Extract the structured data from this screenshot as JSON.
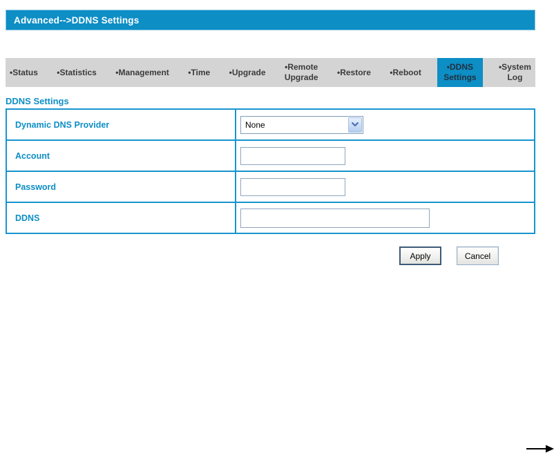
{
  "header": {
    "title": "Advanced--&gt;DDNS Settings"
  },
  "nav": {
    "items": [
      {
        "label": "•Status",
        "active": false
      },
      {
        "label": "•Statistics",
        "active": false
      },
      {
        "label": "•Management",
        "active": false
      },
      {
        "label": "•Time",
        "active": false
      },
      {
        "label": "•Upgrade",
        "active": false
      },
      {
        "label": "•Remote\nUpgrade",
        "active": false
      },
      {
        "label": "•Restore",
        "active": false
      },
      {
        "label": "•Reboot",
        "active": false
      },
      {
        "label": "•DDNS\nSettings",
        "active": true
      },
      {
        "label": "•System\nLog",
        "active": false
      }
    ]
  },
  "form": {
    "section_title": "DDNS Settings",
    "rows": [
      {
        "label": "Dynamic DNS Provider",
        "control": "select",
        "value": "None"
      },
      {
        "label": "Account",
        "control": "input",
        "value": ""
      },
      {
        "label": "Password",
        "control": "input",
        "value": ""
      },
      {
        "label": "DDNS",
        "control": "input",
        "value": ""
      }
    ],
    "apply_label": "Apply",
    "cancel_label": "Cancel"
  },
  "icons": {
    "combo_arrow": "chevron-down-icon",
    "bottom_arrow": "right-arrow-icon"
  },
  "colors": {
    "accent_blue": "#0d8ec5",
    "table_border_blue": "#1694ce",
    "nav_background": "#d4d4d4",
    "input_border": "#7f9db9",
    "header_text": "#ffffff"
  }
}
